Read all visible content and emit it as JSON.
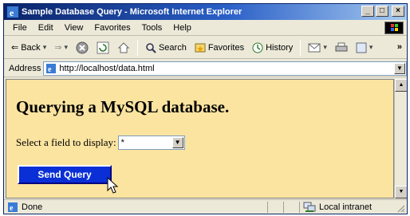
{
  "window": {
    "title": "Sample Database Query - Microsoft Internet Explorer",
    "minimize_glyph": "_",
    "maximize_glyph": "□",
    "close_glyph": "×"
  },
  "menu": [
    "File",
    "Edit",
    "View",
    "Favorites",
    "Tools",
    "Help"
  ],
  "toolbar": {
    "back_label": "Back",
    "search_label": "Search",
    "favorites_label": "Favorites",
    "history_label": "History",
    "more_glyph": "»"
  },
  "address": {
    "label": "Address",
    "url": "http://localhost/data.html"
  },
  "page": {
    "heading": "Querying a MySQL database.",
    "field_label": "Select a field to display:",
    "select_value": "*",
    "button_label": "Send Query"
  },
  "status": {
    "text": "Done",
    "zone": "Local intranet"
  },
  "colors": {
    "page_background": "#fbe4a0",
    "button_background": "#0a2fd6",
    "titlebar": "#0a246a"
  }
}
